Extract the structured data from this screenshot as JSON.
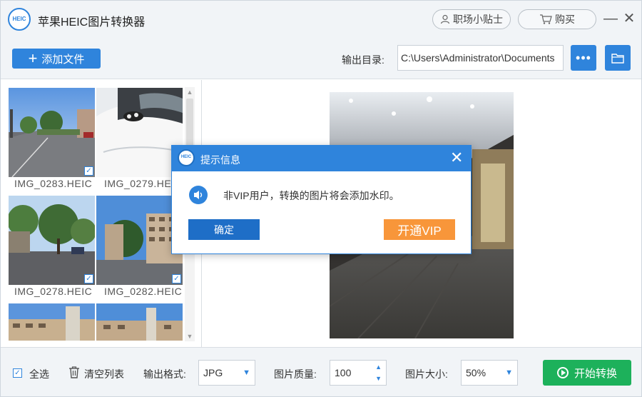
{
  "app": {
    "title": "苹果HEIC图片转换器",
    "logo_text": "HEIC",
    "tips_label": "职场小贴士",
    "buy_label": "购买",
    "minimize": "—",
    "close": "✕"
  },
  "toolbar": {
    "add_file_label": "添加文件",
    "output_dir_label": "输出目录:",
    "output_dir_value": "C:\\Users\\Administrator\\Documents",
    "more_label": "•••"
  },
  "files": [
    {
      "name": "IMG_0283.HEIC",
      "checked": true
    },
    {
      "name": "IMG_0279.HEIC",
      "checked": true
    },
    {
      "name": "IMG_0278.HEIC",
      "checked": true
    },
    {
      "name": "IMG_0282.HEIC",
      "checked": true
    }
  ],
  "check_mark": "✓",
  "bottom": {
    "select_all_label": "全选",
    "clear_list_label": "清空列表",
    "output_format_label": "输出格式:",
    "output_format_value": "JPG",
    "quality_label": "图片质量:",
    "quality_value": "100",
    "size_label": "图片大小:",
    "size_value": "50%",
    "start_label": "开始转换"
  },
  "dialog": {
    "title": "提示信息",
    "logo_text": "HEIC",
    "message": "非VIP用户，转换的图片将会添加水印。",
    "ok_label": "确定",
    "vip_label": "开通VIP",
    "close": "✕"
  },
  "colors": {
    "accent": "#2f84dc",
    "start_green": "#1db15b",
    "vip_orange": "#f8963a",
    "panel_bg": "#f1f4f7"
  }
}
